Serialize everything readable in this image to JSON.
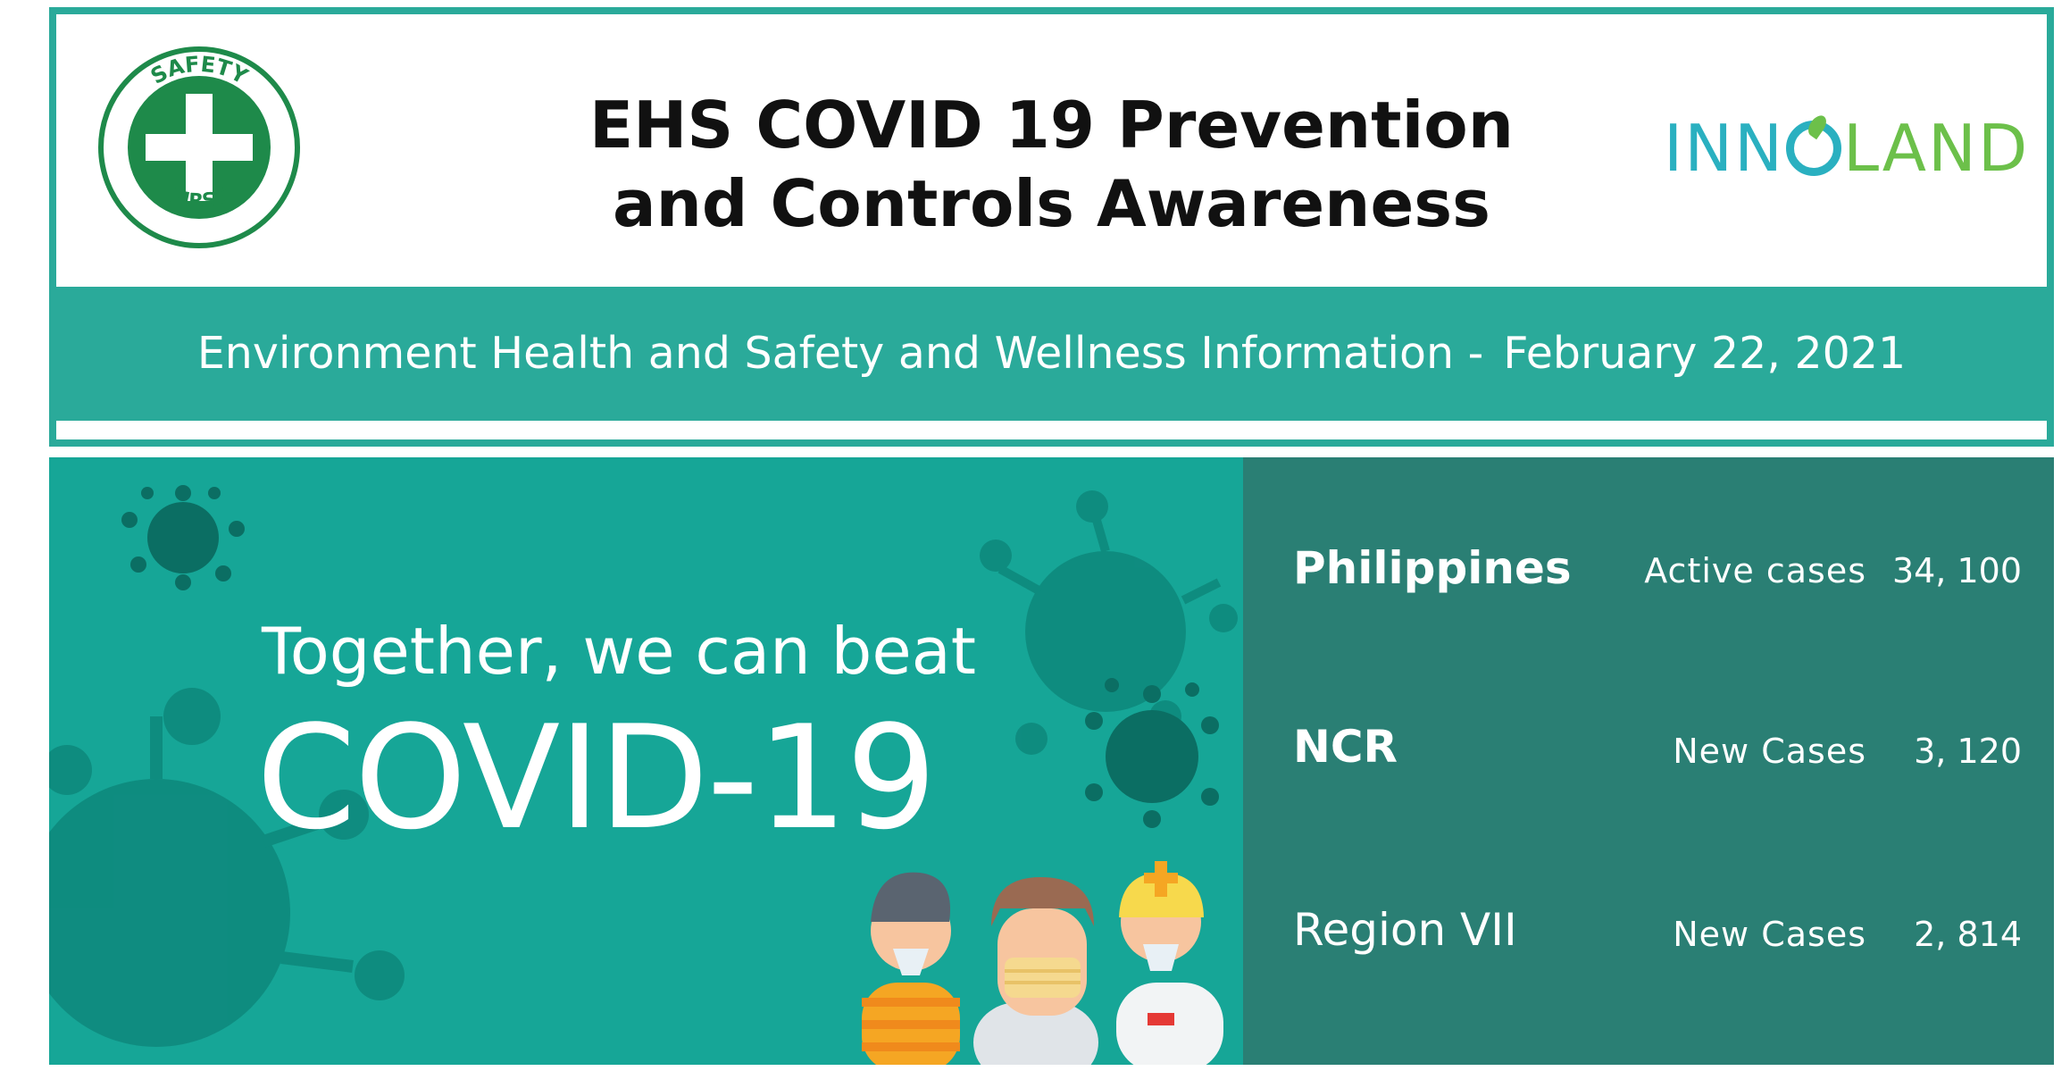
{
  "header": {
    "title_line1": "EHS COVID 19 Prevention",
    "title_line2": "and Controls Awareness",
    "safety_badge_top": "SAFETY",
    "safety_badge_bottom": "FIRST",
    "brand_part1": "INN",
    "brand_part2": "LAND"
  },
  "subtitle": {
    "text": "Environment Health and Safety and Wellness Information -",
    "date": "February 22, 2021"
  },
  "banner": {
    "line1": "Together, we can beat",
    "line2": "COVID-19"
  },
  "stats": [
    {
      "region": "Philippines",
      "metric": "Active cases",
      "value": "34, 100"
    },
    {
      "region": "NCR",
      "metric": "New Cases",
      "value": "3, 120"
    },
    {
      "region": "Region VII",
      "metric": "New Cases",
      "value": "2, 814"
    }
  ],
  "colors": {
    "teal": "#2aaa9a",
    "dark_teal": "#2a7f74",
    "safety_green": "#1e8a4a"
  }
}
